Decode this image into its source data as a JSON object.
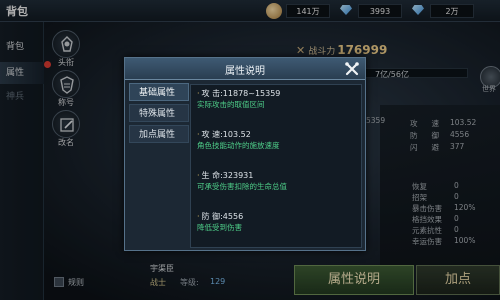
{
  "header": {
    "title": "背包",
    "coins": "141万",
    "gems": "3993",
    "bound_gems": "2万"
  },
  "left_nav": {
    "items": [
      {
        "label": "背包"
      },
      {
        "label": "属性"
      },
      {
        "label": "神兵"
      }
    ],
    "sub_icons": [
      {
        "label": "头衔"
      },
      {
        "label": "称号"
      },
      {
        "label": "改名"
      }
    ]
  },
  "character": {
    "power_label": "战斗力",
    "power_value": "176999",
    "exp_text": "7亿/56亿",
    "exp_fraction": 0.125,
    "world_label": "世界",
    "name": "宇渠臣",
    "class": "战士",
    "level_label": "等级:",
    "level": "129"
  },
  "stats": {
    "left_partial": "5359",
    "top": [
      {
        "label": "攻",
        "value": "103.52"
      },
      {
        "label": "防",
        "value": "4556"
      },
      {
        "label": "闪",
        "value": "377"
      }
    ],
    "top_second_char": [
      "速",
      "御",
      "避"
    ],
    "bottom": [
      {
        "label": "恢复",
        "value": "0"
      },
      {
        "label": "招架",
        "value": "0"
      },
      {
        "label": "暴击伤害",
        "value": "120%"
      },
      {
        "label": "格挡效果",
        "value": "0"
      },
      {
        "label": "元素抗性",
        "value": "0"
      },
      {
        "label": "幸运伤害",
        "value": "100%"
      }
    ]
  },
  "bottom": {
    "rules_label": "规则",
    "attr_btn": "属性说明",
    "add_btn": "加点"
  },
  "modal": {
    "title": "属性说明",
    "tabs": [
      {
        "label": "基础属性"
      },
      {
        "label": "特殊属性"
      },
      {
        "label": "加点属性"
      }
    ],
    "entries": [
      {
        "name": "攻    击:",
        "value": "11878~15359",
        "desc": "实际攻击的取值区间"
      },
      {
        "name": "攻    速:",
        "value": "103.52",
        "desc": "角色技能动作的施放速度"
      },
      {
        "name": "生    命:",
        "value": "323931",
        "desc": "可承受伤害扣除的生命总值"
      },
      {
        "name": "防    御:",
        "value": "4556",
        "desc": "降低受到伤害"
      }
    ]
  },
  "colors": {
    "green_desc": "#4fd08a",
    "gold": "#e9c886",
    "modal_header": "#3e5a73"
  }
}
